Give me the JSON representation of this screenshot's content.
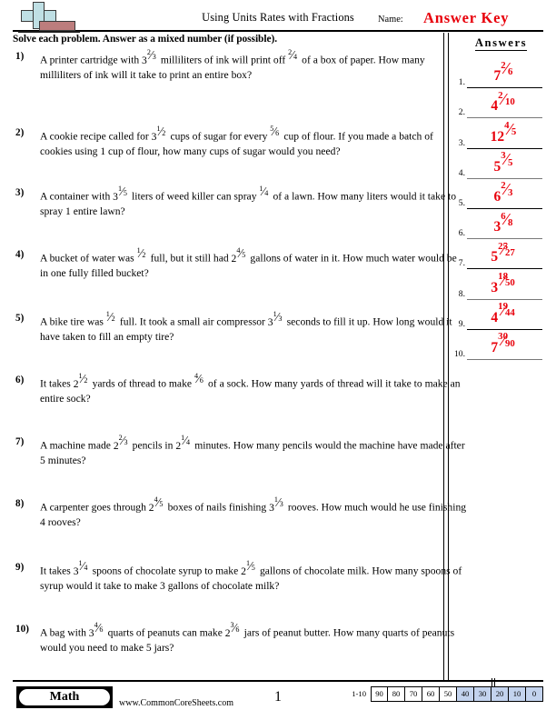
{
  "header": {
    "title": "Using Units Rates with Fractions",
    "name_label": "Name:",
    "answer_key": "Answer Key",
    "logo_icon": "plus-block-logo"
  },
  "instruction": "Solve each problem. Answer as a mixed number (if possible).",
  "answers_column": {
    "heading": "Answers",
    "items": [
      {
        "index": "1.",
        "whole": "7",
        "num": "2",
        "den": "6"
      },
      {
        "index": "2.",
        "whole": "4",
        "num": "2",
        "den": "10"
      },
      {
        "index": "3.",
        "whole": "12",
        "num": "4",
        "den": "5"
      },
      {
        "index": "4.",
        "whole": "5",
        "num": "3",
        "den": "5"
      },
      {
        "index": "5.",
        "whole": "6",
        "num": "2",
        "den": "3"
      },
      {
        "index": "6.",
        "whole": "3",
        "num": "6",
        "den": "8"
      },
      {
        "index": "7.",
        "whole": "5",
        "num": "25",
        "den": "27"
      },
      {
        "index": "8.",
        "whole": "3",
        "num": "18",
        "den": "50"
      },
      {
        "index": "9.",
        "whole": "4",
        "num": "19",
        "den": "44"
      },
      {
        "index": "10.",
        "whole": "7",
        "num": "30",
        "den": "90"
      }
    ]
  },
  "problems": [
    {
      "number": "1)",
      "parts": [
        {
          "t": "text",
          "v": "A printer cartridge with "
        },
        {
          "t": "mixed",
          "whole": "3",
          "num": "2",
          "den": "3"
        },
        {
          "t": "text",
          "v": " milliliters of ink will print off "
        },
        {
          "t": "mixed",
          "whole": "",
          "num": "2",
          "den": "4"
        },
        {
          "t": "text",
          "v": " of a box of paper. How many milliliters of ink will it take to print an entire box?"
        }
      ]
    },
    {
      "number": "2)",
      "parts": [
        {
          "t": "text",
          "v": "A cookie recipe called for "
        },
        {
          "t": "mixed",
          "whole": "3",
          "num": "1",
          "den": "2"
        },
        {
          "t": "text",
          "v": " cups of sugar for every "
        },
        {
          "t": "mixed",
          "whole": "",
          "num": "5",
          "den": "6"
        },
        {
          "t": "text",
          "v": " cup of flour. If you made a batch of cookies using 1 cup of flour, how many cups of sugar would you need?"
        }
      ]
    },
    {
      "number": "3)",
      "parts": [
        {
          "t": "text",
          "v": "A container with "
        },
        {
          "t": "mixed",
          "whole": "3",
          "num": "1",
          "den": "5"
        },
        {
          "t": "text",
          "v": " liters of weed killer can spray "
        },
        {
          "t": "mixed",
          "whole": "",
          "num": "1",
          "den": "4"
        },
        {
          "t": "text",
          "v": " of a lawn. How many liters would it take to spray 1 entire lawn?"
        }
      ]
    },
    {
      "number": "4)",
      "parts": [
        {
          "t": "text",
          "v": "A bucket of water was "
        },
        {
          "t": "mixed",
          "whole": "",
          "num": "1",
          "den": "2"
        },
        {
          "t": "text",
          "v": " full, but it still had "
        },
        {
          "t": "mixed",
          "whole": "2",
          "num": "4",
          "den": "5"
        },
        {
          "t": "text",
          "v": " gallons of water in it. How much water would be in one fully filled bucket?"
        }
      ]
    },
    {
      "number": "5)",
      "parts": [
        {
          "t": "text",
          "v": "A bike tire was "
        },
        {
          "t": "mixed",
          "whole": "",
          "num": "1",
          "den": "2"
        },
        {
          "t": "text",
          "v": " full. It took a small air compressor "
        },
        {
          "t": "mixed",
          "whole": "3",
          "num": "1",
          "den": "3"
        },
        {
          "t": "text",
          "v": " seconds to fill it up. How long would it have taken to fill an empty tire?"
        }
      ]
    },
    {
      "number": "6)",
      "parts": [
        {
          "t": "text",
          "v": "It takes "
        },
        {
          "t": "mixed",
          "whole": "2",
          "num": "1",
          "den": "2"
        },
        {
          "t": "text",
          "v": " yards of thread to make "
        },
        {
          "t": "mixed",
          "whole": "",
          "num": "4",
          "den": "6"
        },
        {
          "t": "text",
          "v": " of a sock. How many yards of thread will it take to make an entire sock?"
        }
      ]
    },
    {
      "number": "7)",
      "parts": [
        {
          "t": "text",
          "v": "A machine made "
        },
        {
          "t": "mixed",
          "whole": "2",
          "num": "2",
          "den": "3"
        },
        {
          "t": "text",
          "v": " pencils in "
        },
        {
          "t": "mixed",
          "whole": "2",
          "num": "1",
          "den": "4"
        },
        {
          "t": "text",
          "v": " minutes. How many pencils would the machine have made after 5 minutes?"
        }
      ]
    },
    {
      "number": "8)",
      "parts": [
        {
          "t": "text",
          "v": "A carpenter goes through "
        },
        {
          "t": "mixed",
          "whole": "2",
          "num": "4",
          "den": "5"
        },
        {
          "t": "text",
          "v": " boxes of nails finishing "
        },
        {
          "t": "mixed",
          "whole": "3",
          "num": "1",
          "den": "3"
        },
        {
          "t": "text",
          "v": " rooves. How much would he use finishing 4 rooves?"
        }
      ]
    },
    {
      "number": "9)",
      "parts": [
        {
          "t": "text",
          "v": "It takes "
        },
        {
          "t": "mixed",
          "whole": "3",
          "num": "1",
          "den": "4"
        },
        {
          "t": "text",
          "v": " spoons of chocolate syrup to make "
        },
        {
          "t": "mixed",
          "whole": "2",
          "num": "1",
          "den": "5"
        },
        {
          "t": "text",
          "v": " gallons of chocolate milk. How many spoons of syrup would it take to make 3 gallons of chocolate milk?"
        }
      ]
    },
    {
      "number": "10)",
      "parts": [
        {
          "t": "text",
          "v": "A bag with "
        },
        {
          "t": "mixed",
          "whole": "3",
          "num": "4",
          "den": "6"
        },
        {
          "t": "text",
          "v": " quarts of peanuts can make "
        },
        {
          "t": "mixed",
          "whole": "2",
          "num": "3",
          "den": "6"
        },
        {
          "t": "text",
          "v": " jars of peanut butter. How many quarts of peanuts would you need to make 5 jars?"
        }
      ]
    }
  ],
  "footer": {
    "subject_badge": "Math",
    "site_url": "www.CommonCoreSheets.com",
    "page_number": "1",
    "scale_range": "1-10",
    "scale_cells": [
      {
        "label": "90",
        "highlighted": false
      },
      {
        "label": "80",
        "highlighted": false
      },
      {
        "label": "70",
        "highlighted": false
      },
      {
        "label": "60",
        "highlighted": false
      },
      {
        "label": "50",
        "highlighted": false
      },
      {
        "label": "40",
        "highlighted": true
      },
      {
        "label": "30",
        "highlighted": true
      },
      {
        "label": "20",
        "highlighted": true
      },
      {
        "label": "10",
        "highlighted": true
      },
      {
        "label": "0",
        "highlighted": true
      }
    ]
  },
  "colors": {
    "answer_red": "#e8000b",
    "scale_highlight": "#c3d3ee",
    "logo_blue": "#bfdfe4",
    "logo_red": "#bc7d7d"
  }
}
